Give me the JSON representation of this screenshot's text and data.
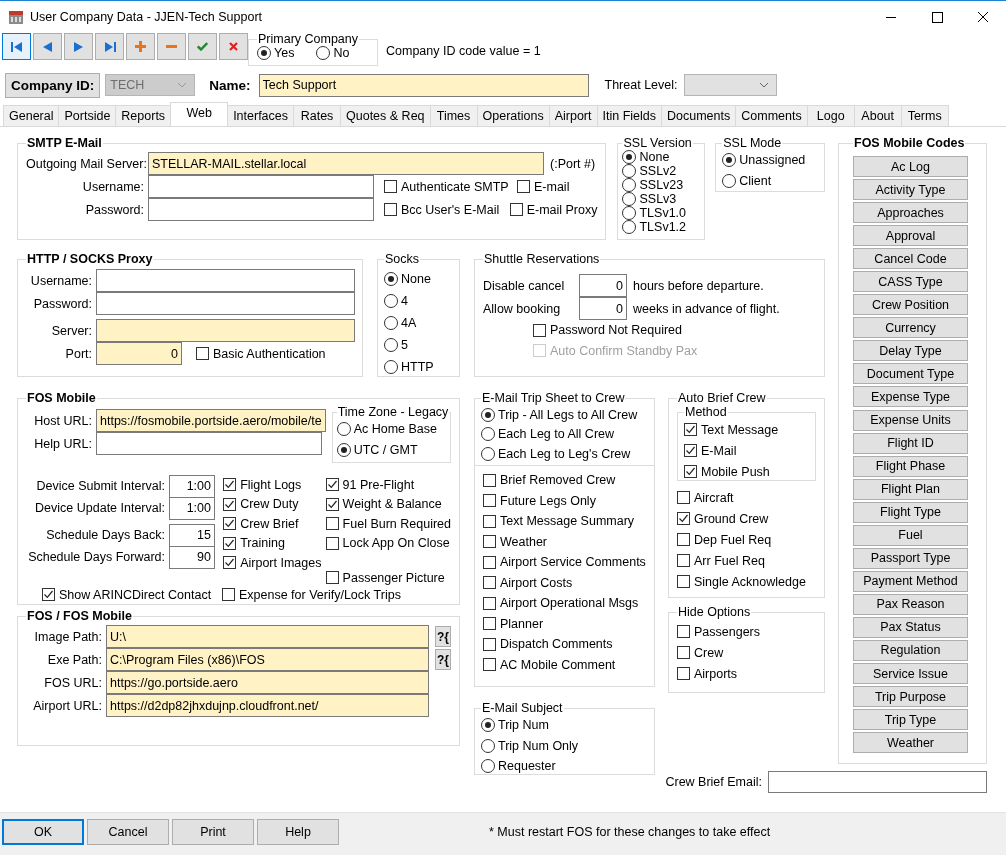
{
  "window": {
    "title": "User Company Data - JJEN-Tech Support"
  },
  "toolbar": [
    {
      "kind": "first",
      "focused": true
    },
    {
      "kind": "prev",
      "focused": false
    },
    {
      "kind": "next",
      "focused": false
    },
    {
      "kind": "last",
      "focused": false
    },
    {
      "kind": "add",
      "focused": false
    },
    {
      "kind": "remove",
      "focused": false
    },
    {
      "kind": "save",
      "focused": false
    },
    {
      "kind": "cancel",
      "focused": false
    }
  ],
  "primary_company": {
    "title": "Primary Company",
    "options": [
      {
        "label": "Yes",
        "selected": true
      },
      {
        "label": "No",
        "selected": false
      }
    ]
  },
  "company_id_note": "Company ID code value = 1",
  "company_id": {
    "label": "Company ID:",
    "value": "TECH",
    "disabled": true
  },
  "name": {
    "label": "Name:",
    "value": "Tech Support",
    "required": true
  },
  "threat_level": {
    "label": "Threat Level:"
  },
  "tabs": [
    {
      "label": "General",
      "selected": false
    },
    {
      "label": "Portside",
      "selected": false
    },
    {
      "label": "Reports",
      "selected": false
    },
    {
      "label": "Web",
      "selected": true
    },
    {
      "label": "Interfaces",
      "selected": false
    },
    {
      "label": "Rates",
      "selected": false
    },
    {
      "label": "Quotes & Req",
      "selected": false
    },
    {
      "label": "Times",
      "selected": false
    },
    {
      "label": "Operations",
      "selected": false
    },
    {
      "label": "Airport",
      "selected": false
    },
    {
      "label": "Itin Fields",
      "selected": false
    },
    {
      "label": "Documents",
      "selected": false
    },
    {
      "label": "Comments",
      "selected": false
    },
    {
      "label": "Logo",
      "selected": false
    },
    {
      "label": "About",
      "selected": false
    },
    {
      "label": "Terms",
      "selected": false
    }
  ],
  "smtp": {
    "title": "SMTP E-Mail",
    "server": {
      "label": "Outgoing Mail Server:",
      "value": "STELLAR-MAIL.stellar.local",
      "required": true
    },
    "port_note": "(:Port #)",
    "fields": [
      {
        "label": "Username:",
        "required": false
      },
      {
        "label": "Password:",
        "required": false
      }
    ],
    "checks": [
      {
        "label": "Authenticate SMTP",
        "checked": false
      },
      {
        "label": "E-mail",
        "checked": false
      },
      {
        "label": "Bcc User's E-Mail",
        "checked": false
      },
      {
        "label": "E-mail Proxy",
        "checked": false
      }
    ]
  },
  "ssl_version": {
    "title": "SSL Version",
    "options": [
      {
        "label": "None",
        "selected": true
      },
      {
        "label": "SSLv2",
        "selected": false
      },
      {
        "label": "SSLv23",
        "selected": false
      },
      {
        "label": "SSLv3",
        "selected": false
      },
      {
        "label": "TLSv1.0",
        "selected": false
      },
      {
        "label": "TLSv1.2",
        "selected": false
      }
    ]
  },
  "ssl_mode": {
    "title": "SSL Mode",
    "options": [
      {
        "label": "Unassigned",
        "selected": true
      },
      {
        "label": "Client",
        "selected": false
      }
    ]
  },
  "proxy": {
    "title": "HTTP / SOCKS Proxy",
    "fields": [
      {
        "label": "Username:",
        "required": false
      },
      {
        "label": "Password:",
        "required": false
      },
      {
        "label": "Server:",
        "required": true
      }
    ],
    "port": {
      "label": "Port:",
      "value": "0",
      "required": true
    },
    "basic_auth": {
      "label": "Basic Authentication",
      "checked": false
    }
  },
  "socks": {
    "title": "Socks",
    "options": [
      {
        "label": "None",
        "selected": true
      },
      {
        "label": "4",
        "selected": false
      },
      {
        "label": "4A",
        "selected": false
      },
      {
        "label": "5",
        "selected": false
      },
      {
        "label": "HTTP",
        "selected": false
      }
    ]
  },
  "shuttle": {
    "title": "Shuttle Reservations",
    "rows": [
      {
        "label": "Disable cancel",
        "value": "0",
        "suffix": "hours before departure."
      },
      {
        "label": "Allow booking",
        "value": "0",
        "suffix": "weeks in advance of flight."
      }
    ],
    "checks": [
      {
        "label": "Password Not Required",
        "checked": false,
        "disabled": false
      },
      {
        "label": "Auto Confirm Standby Pax",
        "checked": false,
        "disabled": true
      }
    ]
  },
  "fos_mobile": {
    "title": "FOS Mobile",
    "urls": [
      {
        "label": "Host URL:",
        "value": "https://fosmobile.portside.aero/mobile/te",
        "required": true
      },
      {
        "label": "Help URL:",
        "required": false
      }
    ],
    "time_zone": {
      "title": "Time Zone - Legacy",
      "options": [
        {
          "label": "Ac Home Base",
          "selected": false
        },
        {
          "label": "UTC / GMT",
          "selected": true
        }
      ]
    },
    "intervals": [
      {
        "label": "Device Submit Interval:",
        "value": "1:00"
      },
      {
        "label": "Device Update Interval:",
        "value": "1:00"
      }
    ],
    "schedule_days": [
      {
        "label": "Schedule Days Back:",
        "value": "15"
      },
      {
        "label": "Schedule Days Forward:",
        "value": "90"
      }
    ],
    "checks_a": [
      {
        "label": "Flight Logs",
        "checked": true
      },
      {
        "label": "Crew Duty",
        "checked": true
      },
      {
        "label": "Crew Brief",
        "checked": true
      },
      {
        "label": "Training",
        "checked": true
      },
      {
        "label": "Airport Images",
        "checked": true
      }
    ],
    "checks_b": [
      {
        "label": "91 Pre-Flight",
        "checked": true
      },
      {
        "label": "Weight & Balance",
        "checked": true
      },
      {
        "label": "Fuel Burn Required",
        "checked": false
      },
      {
        "label": "Lock App On Close",
        "checked": false
      },
      {
        "label": "Passenger Picture",
        "checked": false
      }
    ],
    "bottom_checks": [
      {
        "label": "Show ARINCDirect Contact",
        "checked": true
      },
      {
        "label": "Expense for Verify/Lock Trips",
        "checked": false
      }
    ]
  },
  "fos": {
    "title": "FOS / FOS Mobile",
    "paths": [
      {
        "label": "Image Path:",
        "value": "U:\\",
        "button": "?{"
      },
      {
        "label": "Exe Path:",
        "value": "C:\\Program Files (x86)\\FOS",
        "button": "?{"
      },
      {
        "label": "FOS URL:",
        "value": "https://go.portside.aero"
      },
      {
        "label": "Airport URL:",
        "value": "https://d2dp82jhxdujnp.cloudfront.net/"
      }
    ]
  },
  "email_trip_sheet": {
    "title": "E-Mail Trip Sheet to Crew",
    "options": [
      {
        "label": "Trip - All Legs to All Crew",
        "selected": true
      },
      {
        "label": "Each Leg to All Crew",
        "selected": false
      },
      {
        "label": "Each Leg to Leg's Crew",
        "selected": false
      }
    ],
    "checks": [
      {
        "label": "Brief Removed Crew",
        "checked": false
      },
      {
        "label": "Future Legs Only",
        "checked": false
      },
      {
        "label": "Text Message Summary",
        "checked": false
      },
      {
        "label": "Weather",
        "checked": false
      },
      {
        "label": "Airport Service Comments",
        "checked": false
      },
      {
        "label": "Airport Costs",
        "checked": false
      },
      {
        "label": "Airport Operational Msgs",
        "checked": false
      },
      {
        "label": "Planner",
        "checked": false
      },
      {
        "label": "Dispatch Comments",
        "checked": false
      },
      {
        "label": "AC Mobile Comment",
        "checked": false
      }
    ]
  },
  "email_subject": {
    "title": "E-Mail Subject",
    "options": [
      {
        "label": "Trip Num",
        "selected": true
      },
      {
        "label": "Trip Num Only",
        "selected": false
      },
      {
        "label": "Requester",
        "selected": false
      }
    ]
  },
  "auto_brief": {
    "title": "Auto Brief Crew",
    "method": {
      "title": "Method",
      "checks": [
        {
          "label": "Text Message",
          "checked": true
        },
        {
          "label": "E-Mail",
          "checked": true
        },
        {
          "label": "Mobile Push",
          "checked": true
        }
      ]
    },
    "checks": [
      {
        "label": "Aircraft",
        "checked": false
      },
      {
        "label": "Ground Crew",
        "checked": true
      },
      {
        "label": "Dep Fuel Req",
        "checked": false
      },
      {
        "label": "Arr Fuel Req",
        "checked": false
      },
      {
        "label": "Single Acknowledge",
        "checked": false
      }
    ]
  },
  "hide_options": {
    "title": "Hide Options",
    "checks": [
      {
        "label": "Passengers",
        "checked": false
      },
      {
        "label": "Crew",
        "checked": false
      },
      {
        "label": "Airports",
        "checked": false
      }
    ]
  },
  "mobile_codes": {
    "title": "FOS Mobile Codes",
    "buttons": [
      "Ac Log",
      "Activity Type",
      "Approaches",
      "Approval",
      "Cancel Code",
      "CASS Type",
      "Crew Position",
      "Currency",
      "Delay Type",
      "Document Type",
      "Expense Type",
      "Expense Units",
      "Flight ID",
      "Flight Phase",
      "Flight Plan",
      "Flight Type",
      "Fuel",
      "Passport Type",
      "Payment Method",
      "Pax Reason",
      "Pax Status",
      "Regulation",
      "Service Issue",
      "Trip Purpose",
      "Trip Type",
      "Weather"
    ]
  },
  "crew_brief_email": {
    "label": "Crew Brief Email:"
  },
  "footer": {
    "buttons": [
      {
        "label": "OK",
        "focused": true
      },
      {
        "label": "Cancel",
        "focused": false
      },
      {
        "label": "Print",
        "focused": false
      },
      {
        "label": "Help",
        "focused": false
      }
    ],
    "note": "* Must restart FOS for these changes to take effect"
  }
}
